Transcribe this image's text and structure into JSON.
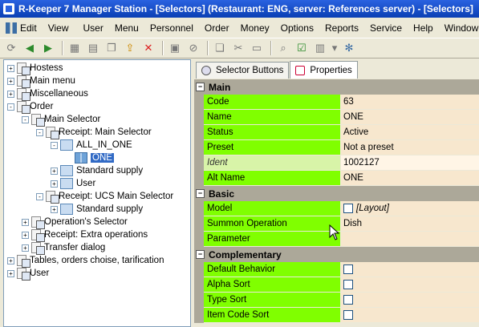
{
  "window": {
    "title": "R-Keeper 7 Manager Station - [Selectors] (Restaurant: ENG, server: References server) - [Selectors]"
  },
  "menu": [
    "Edit",
    "View",
    "User",
    "Menu",
    "Personnel",
    "Order",
    "Money",
    "Options",
    "Reports",
    "Service",
    "Help",
    "Window"
  ],
  "toolbar_icons": [
    "refresh-icon",
    "back-icon",
    "forward-icon",
    "grid-icon",
    "grid2-icon",
    "copy-icon",
    "export-icon",
    "delete-icon",
    "save-icon",
    "cancel-icon",
    "copy2-icon",
    "cut-icon",
    "paste-icon",
    "find-icon",
    "check-icon",
    "layout-icon",
    "dropdown-icon",
    "settings-icon"
  ],
  "tree": [
    {
      "label": "Hostess",
      "indent": 0,
      "exp": "+"
    },
    {
      "label": "Main menu",
      "indent": 0,
      "exp": "+"
    },
    {
      "label": "Miscellaneous",
      "indent": 0,
      "exp": "+"
    },
    {
      "label": "Order",
      "indent": 0,
      "exp": "-"
    },
    {
      "label": "Main Selector",
      "indent": 1,
      "exp": "-"
    },
    {
      "label": "Receipt: Main Selector",
      "indent": 2,
      "exp": "-"
    },
    {
      "label": "ALL_IN_ONE",
      "indent": 3,
      "exp": "-"
    },
    {
      "label": "ONE",
      "indent": 4,
      "exp": "",
      "selected": true
    },
    {
      "label": "Standard supply",
      "indent": 3,
      "exp": "+"
    },
    {
      "label": "User",
      "indent": 3,
      "exp": "+"
    },
    {
      "label": "Receipt: UCS Main Selector",
      "indent": 2,
      "exp": "-"
    },
    {
      "label": "Standard supply",
      "indent": 3,
      "exp": "+"
    },
    {
      "label": "Operation's Selector",
      "indent": 1,
      "exp": "+"
    },
    {
      "label": "Receipt: Extra operations",
      "indent": 1,
      "exp": "+"
    },
    {
      "label": "Transfer dialog",
      "indent": 1,
      "exp": "+"
    },
    {
      "label": "Tables, orders choise, tarification",
      "indent": 0,
      "exp": "+"
    },
    {
      "label": "User",
      "indent": 0,
      "exp": "+"
    }
  ],
  "tabs": [
    {
      "label": "Selector Buttons",
      "active": false
    },
    {
      "label": "Properties",
      "active": true
    }
  ],
  "sections": [
    {
      "title": "Main",
      "rows": [
        {
          "key": "Code",
          "value": "63"
        },
        {
          "key": "Name",
          "value": "ONE"
        },
        {
          "key": "Status",
          "value": "Active"
        },
        {
          "key": "Preset",
          "value": "Not a preset"
        },
        {
          "key": "Ident",
          "value": "1002127",
          "italic": true
        },
        {
          "key": "Alt Name",
          "value": "ONE"
        }
      ]
    },
    {
      "title": "Basic",
      "rows": [
        {
          "key": "Model",
          "value": "[Layout]",
          "checkbox": true
        },
        {
          "key": "Summon Operation",
          "value": "Dish"
        },
        {
          "key": "Parameter",
          "value": ""
        }
      ]
    },
    {
      "title": "Complementary",
      "rows": [
        {
          "key": "Default Behavior",
          "value": "",
          "checkbox": true
        },
        {
          "key": "Alpha Sort",
          "value": "",
          "checkbox": true
        },
        {
          "key": "Type Sort",
          "value": "",
          "checkbox": true
        },
        {
          "key": "Item Code Sort",
          "value": "",
          "checkbox": true
        }
      ]
    }
  ],
  "colors": {
    "key_bg": "#80ff00",
    "value_bg": "#f7e7ce",
    "section_bg": "#aca899",
    "selection": "#316ac5"
  }
}
